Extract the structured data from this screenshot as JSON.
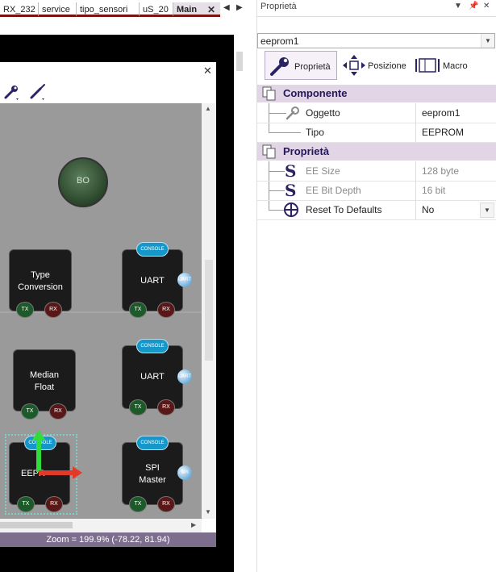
{
  "tabs": [
    {
      "label": "RX_232",
      "active": false
    },
    {
      "label": "service",
      "active": false
    },
    {
      "label": "tipo_sensori",
      "active": false
    },
    {
      "label": "uS_20",
      "active": false
    },
    {
      "label": "Main",
      "active": true
    }
  ],
  "tab_close": "✕",
  "nav_prev": "◀",
  "nav_next": "▶",
  "panel_close": "✕",
  "zoom": "Zoom = 199.9% (-78.22, 81.94)",
  "canvas": {
    "bo_label": "BO",
    "console_label": "CONSOLE",
    "tx_label": "TX",
    "rx_label": "RX",
    "uart_icon": "UART",
    "spi_icon": "SPI",
    "nodes": {
      "type_conversion_1": "Type",
      "type_conversion_2": "Conversion",
      "uart1": "UART",
      "median_1": "Median",
      "median_2": "Float",
      "uart2": "UART",
      "eeprom": "EEPR",
      "spi_1": "SPI",
      "spi_2": "Master"
    }
  },
  "properties": {
    "title": "Proprietà",
    "pin_icon": "📌",
    "close_icon": "✕",
    "dropdown_icon": "▼",
    "object_selector": "eeprom1",
    "tabs": [
      {
        "label": "Proprietà",
        "active": true
      },
      {
        "label": "Posizione",
        "active": false
      },
      {
        "label": "Macro",
        "active": false
      }
    ],
    "categories": [
      {
        "label": "Componente",
        "rows": [
          {
            "key": "Oggetto",
            "value": "eeprom1"
          },
          {
            "key": "Tipo",
            "value": "EEPROM"
          }
        ]
      },
      {
        "label": "Proprietà",
        "rows": [
          {
            "key": "EE Size",
            "value": "128 byte"
          },
          {
            "key": "EE Bit Depth",
            "value": "16 bit"
          },
          {
            "key": "Reset To Defaults",
            "value": "No"
          }
        ]
      }
    ],
    "s_glyph": "S"
  },
  "colors": {
    "accent": "#7d6e8e",
    "tab_underline": "#7a1212",
    "category_bg": "#e2d6e6"
  }
}
